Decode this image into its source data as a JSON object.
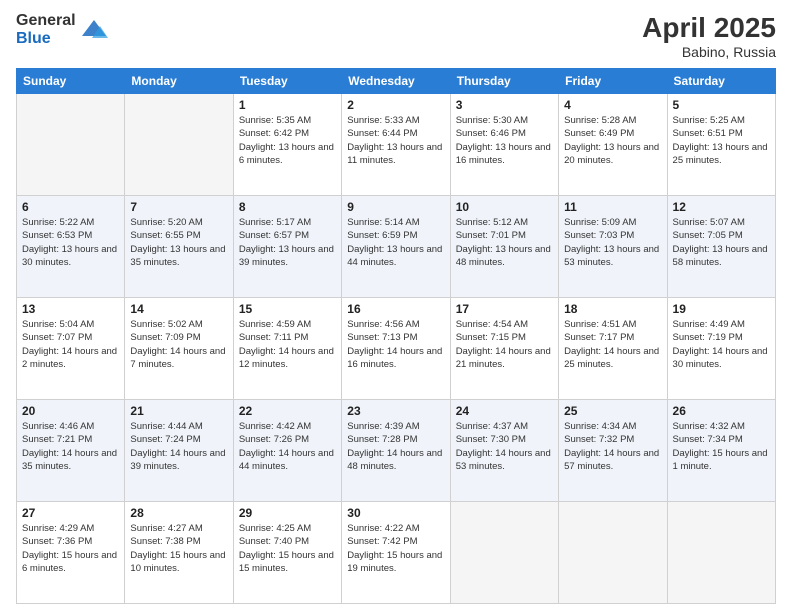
{
  "logo": {
    "general": "General",
    "blue": "Blue"
  },
  "header": {
    "month": "April 2025",
    "location": "Babino, Russia"
  },
  "weekdays": [
    "Sunday",
    "Monday",
    "Tuesday",
    "Wednesday",
    "Thursday",
    "Friday",
    "Saturday"
  ],
  "weeks": [
    [
      {
        "day": "",
        "info": ""
      },
      {
        "day": "",
        "info": ""
      },
      {
        "day": "1",
        "info": "Sunrise: 5:35 AM\nSunset: 6:42 PM\nDaylight: 13 hours and 6 minutes."
      },
      {
        "day": "2",
        "info": "Sunrise: 5:33 AM\nSunset: 6:44 PM\nDaylight: 13 hours and 11 minutes."
      },
      {
        "day": "3",
        "info": "Sunrise: 5:30 AM\nSunset: 6:46 PM\nDaylight: 13 hours and 16 minutes."
      },
      {
        "day": "4",
        "info": "Sunrise: 5:28 AM\nSunset: 6:49 PM\nDaylight: 13 hours and 20 minutes."
      },
      {
        "day": "5",
        "info": "Sunrise: 5:25 AM\nSunset: 6:51 PM\nDaylight: 13 hours and 25 minutes."
      }
    ],
    [
      {
        "day": "6",
        "info": "Sunrise: 5:22 AM\nSunset: 6:53 PM\nDaylight: 13 hours and 30 minutes."
      },
      {
        "day": "7",
        "info": "Sunrise: 5:20 AM\nSunset: 6:55 PM\nDaylight: 13 hours and 35 minutes."
      },
      {
        "day": "8",
        "info": "Sunrise: 5:17 AM\nSunset: 6:57 PM\nDaylight: 13 hours and 39 minutes."
      },
      {
        "day": "9",
        "info": "Sunrise: 5:14 AM\nSunset: 6:59 PM\nDaylight: 13 hours and 44 minutes."
      },
      {
        "day": "10",
        "info": "Sunrise: 5:12 AM\nSunset: 7:01 PM\nDaylight: 13 hours and 48 minutes."
      },
      {
        "day": "11",
        "info": "Sunrise: 5:09 AM\nSunset: 7:03 PM\nDaylight: 13 hours and 53 minutes."
      },
      {
        "day": "12",
        "info": "Sunrise: 5:07 AM\nSunset: 7:05 PM\nDaylight: 13 hours and 58 minutes."
      }
    ],
    [
      {
        "day": "13",
        "info": "Sunrise: 5:04 AM\nSunset: 7:07 PM\nDaylight: 14 hours and 2 minutes."
      },
      {
        "day": "14",
        "info": "Sunrise: 5:02 AM\nSunset: 7:09 PM\nDaylight: 14 hours and 7 minutes."
      },
      {
        "day": "15",
        "info": "Sunrise: 4:59 AM\nSunset: 7:11 PM\nDaylight: 14 hours and 12 minutes."
      },
      {
        "day": "16",
        "info": "Sunrise: 4:56 AM\nSunset: 7:13 PM\nDaylight: 14 hours and 16 minutes."
      },
      {
        "day": "17",
        "info": "Sunrise: 4:54 AM\nSunset: 7:15 PM\nDaylight: 14 hours and 21 minutes."
      },
      {
        "day": "18",
        "info": "Sunrise: 4:51 AM\nSunset: 7:17 PM\nDaylight: 14 hours and 25 minutes."
      },
      {
        "day": "19",
        "info": "Sunrise: 4:49 AM\nSunset: 7:19 PM\nDaylight: 14 hours and 30 minutes."
      }
    ],
    [
      {
        "day": "20",
        "info": "Sunrise: 4:46 AM\nSunset: 7:21 PM\nDaylight: 14 hours and 35 minutes."
      },
      {
        "day": "21",
        "info": "Sunrise: 4:44 AM\nSunset: 7:24 PM\nDaylight: 14 hours and 39 minutes."
      },
      {
        "day": "22",
        "info": "Sunrise: 4:42 AM\nSunset: 7:26 PM\nDaylight: 14 hours and 44 minutes."
      },
      {
        "day": "23",
        "info": "Sunrise: 4:39 AM\nSunset: 7:28 PM\nDaylight: 14 hours and 48 minutes."
      },
      {
        "day": "24",
        "info": "Sunrise: 4:37 AM\nSunset: 7:30 PM\nDaylight: 14 hours and 53 minutes."
      },
      {
        "day": "25",
        "info": "Sunrise: 4:34 AM\nSunset: 7:32 PM\nDaylight: 14 hours and 57 minutes."
      },
      {
        "day": "26",
        "info": "Sunrise: 4:32 AM\nSunset: 7:34 PM\nDaylight: 15 hours and 1 minute."
      }
    ],
    [
      {
        "day": "27",
        "info": "Sunrise: 4:29 AM\nSunset: 7:36 PM\nDaylight: 15 hours and 6 minutes."
      },
      {
        "day": "28",
        "info": "Sunrise: 4:27 AM\nSunset: 7:38 PM\nDaylight: 15 hours and 10 minutes."
      },
      {
        "day": "29",
        "info": "Sunrise: 4:25 AM\nSunset: 7:40 PM\nDaylight: 15 hours and 15 minutes."
      },
      {
        "day": "30",
        "info": "Sunrise: 4:22 AM\nSunset: 7:42 PM\nDaylight: 15 hours and 19 minutes."
      },
      {
        "day": "",
        "info": ""
      },
      {
        "day": "",
        "info": ""
      },
      {
        "day": "",
        "info": ""
      }
    ]
  ]
}
